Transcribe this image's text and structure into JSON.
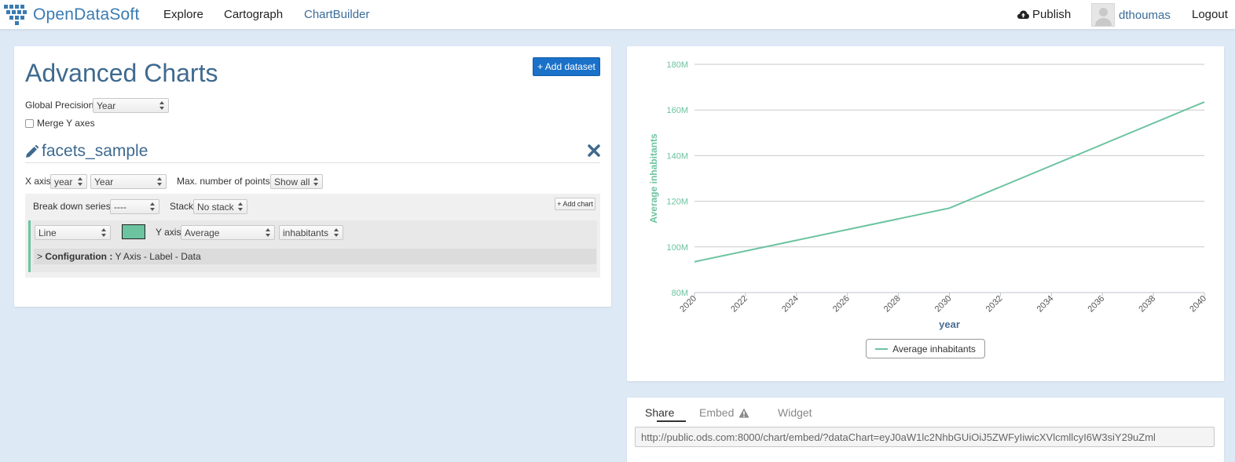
{
  "navbar": {
    "brand": "OpenDataSoft",
    "items": [
      "Explore",
      "Cartograph",
      "ChartBuilder"
    ],
    "publish": "Publish",
    "username": "dthoumas",
    "logout": "Logout"
  },
  "config": {
    "title": "Advanced Charts",
    "add_dataset": "+ Add dataset",
    "global_precision_label": "Global Precision",
    "global_precision_value": "Year",
    "merge_y_axes": "Merge Y axes",
    "dataset_name": "facets_sample",
    "x_axis_label": "X axis",
    "x_axis_field": "year",
    "x_axis_precision": "Year",
    "max_points_label": "Max. number of points",
    "max_points_value": "Show all",
    "break_down_label": "Break down series",
    "break_down_value": "----",
    "stack_label": "Stack",
    "stack_value": "No stack",
    "add_chart": "+ Add chart",
    "chart_type": "Line",
    "series_color": "#6cc3a0",
    "y_axis_label": "Y axis",
    "y_axis_func": "Average",
    "y_axis_field": "inhabitants",
    "configuration_prefix": "> ",
    "configuration_bold": "Configuration :",
    "configuration_rest": " Y Axis - Label - Data"
  },
  "chart_data": {
    "type": "line",
    "xlabel": "year",
    "ylabel": "Average inhabitants",
    "x_ticks": [
      "2020",
      "2022",
      "2024",
      "2026",
      "2028",
      "2030",
      "2032",
      "2034",
      "2036",
      "2038",
      "2040"
    ],
    "y_ticks": [
      "80M",
      "100M",
      "120M",
      "140M",
      "160M",
      "180M"
    ],
    "ylim": [
      80000000,
      180000000
    ],
    "xlim": [
      2020,
      2040
    ],
    "grid": "horizontal",
    "legend": "bottom-center",
    "series": [
      {
        "name": "Average inhabitants",
        "color": "#6cc3a0",
        "x": [
          2020,
          2030,
          2040
        ],
        "y": [
          93500000,
          117000000,
          163500000
        ]
      }
    ]
  },
  "share": {
    "tabs": [
      "Share",
      "Embed",
      "Widget"
    ],
    "url": "http://public.ods.com:8000/chart/embed/?dataChart=eyJ0aW1lc2NhbGUiOiJ5ZWFyIiwicXVlcmllcyI6W3siY29uZml"
  }
}
